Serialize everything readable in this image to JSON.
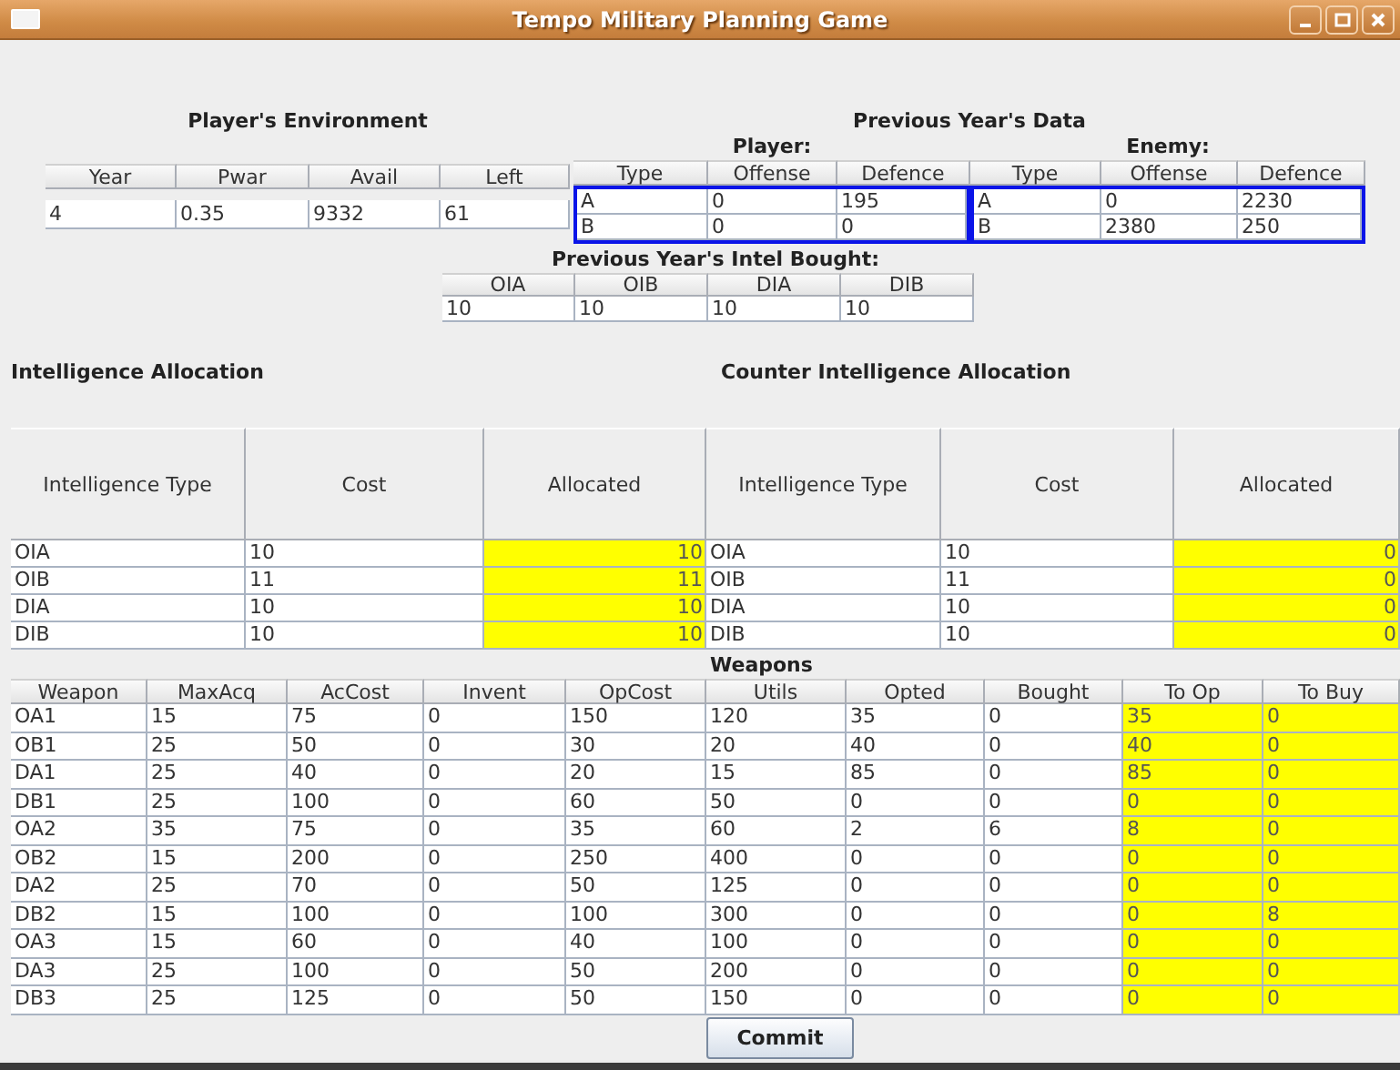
{
  "window": {
    "title": "Tempo Military Planning Game"
  },
  "players_environment": {
    "title": "Player's Environment",
    "columns": [
      "Year",
      "Pwar",
      "Avail",
      "Left"
    ],
    "rows": [
      [
        "4",
        "0.35",
        "9332",
        "61"
      ]
    ]
  },
  "previous_year_data": {
    "title": "Previous Year's Data",
    "player": {
      "label": "Player:",
      "columns": [
        "Type",
        "Offense",
        "Defence"
      ],
      "rows": [
        [
          "A",
          "0",
          "195"
        ],
        [
          "B",
          "0",
          "0"
        ]
      ]
    },
    "enemy": {
      "label": "Enemy:",
      "columns": [
        "Type",
        "Offense",
        "Defence"
      ],
      "rows": [
        [
          "A",
          "0",
          "2230"
        ],
        [
          "B",
          "2380",
          "250"
        ]
      ]
    }
  },
  "previous_intel_bought": {
    "title": "Previous Year's Intel Bought:",
    "columns": [
      "OIA",
      "OIB",
      "DIA",
      "DIB"
    ],
    "rows": [
      [
        "10",
        "10",
        "10",
        "10"
      ]
    ]
  },
  "intelligence_allocation": {
    "title": "Intelligence Allocation",
    "columns": [
      {
        "label": "Intelligence Type",
        "editable": false
      },
      {
        "label": "Cost",
        "editable": false
      },
      {
        "label": "Allocated",
        "editable": true
      }
    ],
    "rows": [
      [
        "OIA",
        "10",
        "10"
      ],
      [
        "OIB",
        "11",
        "11"
      ],
      [
        "DIA",
        "10",
        "10"
      ],
      [
        "DIB",
        "10",
        "10"
      ]
    ]
  },
  "counter_intelligence_allocation": {
    "title": "Counter Intelligence Allocation",
    "columns": [
      {
        "label": "Intelligence Type",
        "editable": false
      },
      {
        "label": "Cost",
        "editable": false
      },
      {
        "label": "Allocated",
        "editable": true
      }
    ],
    "rows": [
      [
        "OIA",
        "10",
        "0"
      ],
      [
        "OIB",
        "11",
        "0"
      ],
      [
        "DIA",
        "10",
        "0"
      ],
      [
        "DIB",
        "10",
        "0"
      ]
    ]
  },
  "weapons": {
    "title": "Weapons",
    "columns": [
      {
        "label": "Weapon",
        "editable": false
      },
      {
        "label": "MaxAcq",
        "editable": false
      },
      {
        "label": "AcCost",
        "editable": false
      },
      {
        "label": "Invent",
        "editable": false
      },
      {
        "label": "OpCost",
        "editable": false
      },
      {
        "label": "Utils",
        "editable": false
      },
      {
        "label": "Opted",
        "editable": false
      },
      {
        "label": "Bought",
        "editable": false
      },
      {
        "label": "To Op",
        "editable": true
      },
      {
        "label": "To Buy",
        "editable": true
      }
    ],
    "rows": [
      [
        "OA1",
        "15",
        "75",
        "0",
        "150",
        "120",
        "35",
        "0",
        "35",
        "0"
      ],
      [
        "OB1",
        "25",
        "50",
        "0",
        "30",
        "20",
        "40",
        "0",
        "40",
        "0"
      ],
      [
        "DA1",
        "25",
        "40",
        "0",
        "20",
        "15",
        "85",
        "0",
        "85",
        "0"
      ],
      [
        "DB1",
        "25",
        "100",
        "0",
        "60",
        "50",
        "0",
        "0",
        "0",
        "0"
      ],
      [
        "OA2",
        "35",
        "75",
        "0",
        "35",
        "60",
        "2",
        "6",
        "8",
        "0"
      ],
      [
        "OB2",
        "15",
        "200",
        "0",
        "250",
        "400",
        "0",
        "0",
        "0",
        "0"
      ],
      [
        "DA2",
        "25",
        "70",
        "0",
        "50",
        "125",
        "0",
        "0",
        "0",
        "0"
      ],
      [
        "DB2",
        "15",
        "100",
        "0",
        "100",
        "300",
        "0",
        "0",
        "0",
        "8"
      ],
      [
        "OA3",
        "15",
        "60",
        "0",
        "40",
        "100",
        "0",
        "0",
        "0",
        "0"
      ],
      [
        "DA3",
        "25",
        "100",
        "0",
        "50",
        "200",
        "0",
        "0",
        "0",
        "0"
      ],
      [
        "DB3",
        "25",
        "125",
        "0",
        "50",
        "150",
        "0",
        "0",
        "0",
        "0"
      ]
    ]
  },
  "buttons": [
    {
      "label": "Commit"
    }
  ]
}
